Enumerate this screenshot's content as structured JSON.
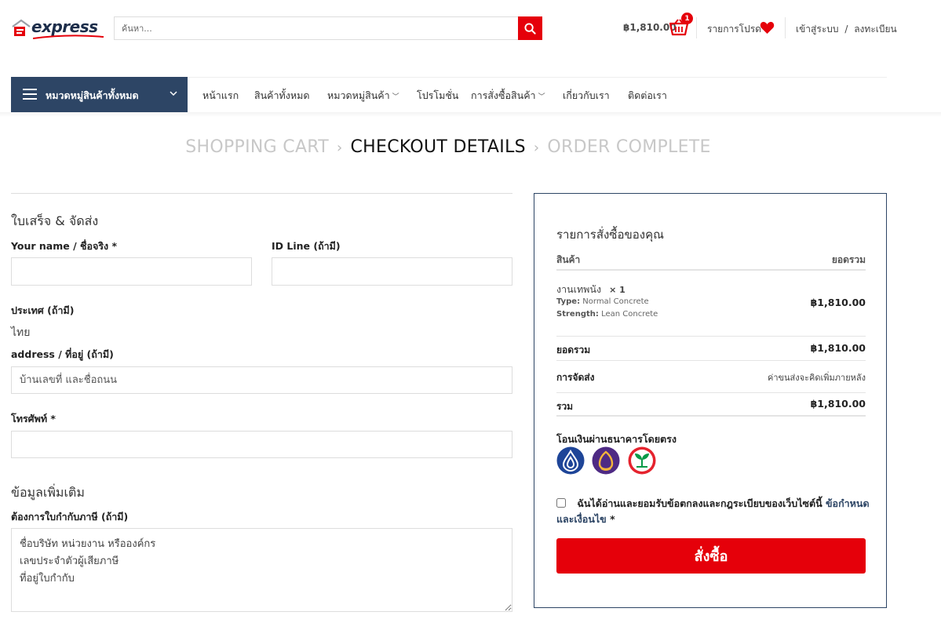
{
  "header": {
    "logo_text": "express",
    "search_placeholder": "ค้นหา...",
    "cart_total": "฿1,810.00",
    "cart_count": "1",
    "wishlist_label": "รายการโปรด",
    "login_label": "เข้าสู่ระบบ",
    "login_sep": "/",
    "register_label": "ลงทะเบียน"
  },
  "nav": {
    "all_categories": "หมวดหมู่สินค้าทั้งหมด",
    "items": [
      {
        "label": "หน้าแรก"
      },
      {
        "label": "สินค้าทั้งหมด"
      },
      {
        "label": "หมวดหมู่สินค้า"
      },
      {
        "label": "โปรโมชั่น"
      },
      {
        "label": "การสั่งซื้อสินค้า"
      },
      {
        "label": "เกี่ยวกับเรา"
      },
      {
        "label": "ติดต่อเรา"
      }
    ]
  },
  "breadcrumb": {
    "cart": "SHOPPING CART",
    "checkout": "CHECKOUT DETAILS",
    "complete": "ORDER COMPLETE",
    "sep": "›"
  },
  "billing": {
    "title": "ใบเสร็จ & จัดส่ง",
    "name_label": "Your name / ชื่อจริง *",
    "name_value": "",
    "line_label": "ID Line  (ถ้ามี)",
    "line_value": "",
    "country_label": "ประเทศ (ถ้ามี)",
    "country_value": "ไทย",
    "address_label": "address / ที่อยู่ (ถ้ามี)",
    "address_placeholder": "บ้านเลขที่ และชื่อถนน",
    "phone_label": "โทรศัพท์ *",
    "phone_value": ""
  },
  "additional": {
    "title": "ข้อมูลเพิ่มเติม",
    "invoice_label": "ต้องการใบกำกับภาษี (ถ้ามี)",
    "invoice_placeholder": "ชื่อบริษัท หน่วยงาน หรือองค์กร\nเลขประจำตัวผู้เสียภาษี\nที่อยู่ใบกำกับ"
  },
  "order": {
    "title": "รายการสั่งซื้อของคุณ",
    "col_product": "สินค้า",
    "col_total": "ยอดรวม",
    "item_name": "งานเทพนัง",
    "item_qty": "× 1",
    "item_type_key": "Type:",
    "item_type_val": "Normal Concrete",
    "item_strength_key": "Strength:",
    "item_strength_val": "Lean Concrete",
    "item_price": "฿1,810.00",
    "subtotal_label": "ยอดรวม",
    "subtotal_value": "฿1,810.00",
    "shipping_label": "การจัดส่ง",
    "shipping_value": "ค่าขนส่งจะคิดเพิ่มภายหลัง",
    "total_label": "รวม",
    "total_value": "฿1,810.00",
    "payment_title": "โอนเงินผ่านธนาคารโดยตรง",
    "banks": [
      {
        "icon": "bangkok-bank-icon",
        "color": "#1e4598"
      },
      {
        "icon": "siam-commercial-bank-icon",
        "color": "#4e2a84"
      },
      {
        "icon": "kasikorn-bank-icon",
        "color": "#0a9a48"
      }
    ],
    "terms_text": "ฉันได้อ่านและยอมรับข้อตกลงและกฎระเบียบของเว็บไซต์นี้",
    "terms_link": "ข้อกำหนดและเงื่อนไข",
    "terms_required": "*",
    "place_order": "สั่งซื้อ"
  },
  "colors": {
    "brand_navy": "#2d4565",
    "accent_red": "#e5000a"
  }
}
